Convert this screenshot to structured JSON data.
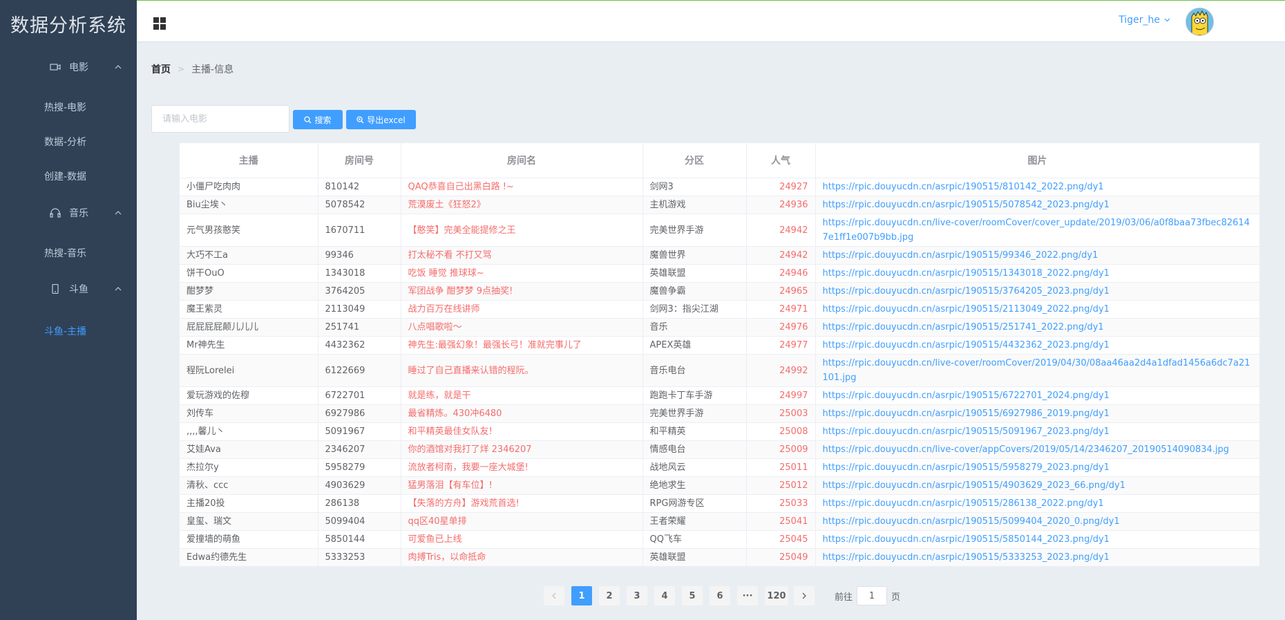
{
  "app": {
    "title": "数据分析系统"
  },
  "sidebar": {
    "groups": [
      {
        "label": "电影",
        "icon": "video-camera-icon",
        "items": [
          "热搜-电影",
          "数据-分析",
          "创建-数据"
        ]
      },
      {
        "label": "音乐",
        "icon": "headset-icon",
        "items": [
          "热搜-音乐"
        ]
      },
      {
        "label": "斗鱼",
        "icon": "mobile-phone-icon",
        "items": [
          "斗鱼-主播"
        ]
      }
    ],
    "active_item": "斗鱼-主播"
  },
  "header": {
    "username": "Tiger_he"
  },
  "breadcrumb": {
    "home": "首页",
    "current": "主播-信息"
  },
  "toolbar": {
    "search_placeholder": "请输入电影",
    "search_label": "搜索",
    "export_label": "导出excel"
  },
  "table": {
    "columns": [
      "主播",
      "房间号",
      "房间名",
      "分区",
      "人气",
      "图片"
    ],
    "rows": [
      [
        "小僵尸吃肉肉",
        "810142",
        "QAQ恭喜自己出黑白路 !~",
        "剑网3",
        "24927",
        "https://rpic.douyucdn.cn/asrpic/190515/810142_2022.png/dy1"
      ],
      [
        "Biu尘埃丶",
        "5078542",
        "荒漠废土《狂怒2》",
        "主机游戏",
        "24936",
        "https://rpic.douyucdn.cn/asrpic/190515/5078542_2023.png/dy1"
      ],
      [
        "元气男孩憨笑",
        "1670711",
        "【憨笑】完美全能提修之王",
        "完美世界手游",
        "24942",
        "https://rpic.douyucdn.cn/live-cover/roomCover/cover_update/2019/03/06/a0f8baa73fbec826147e1ff1e007b9bb.jpg"
      ],
      [
        "大巧不工a",
        "99346",
        "打太秘不看 不打又骂",
        "魔兽世界",
        "24942",
        "https://rpic.douyucdn.cn/asrpic/190515/99346_2022.png/dy1"
      ],
      [
        "饼干OuO",
        "1343018",
        "吃饭 睡觉 推球球~",
        "英雄联盟",
        "24946",
        "https://rpic.douyucdn.cn/asrpic/190515/1343018_2022.png/dy1"
      ],
      [
        "酣梦梦",
        "3764205",
        "军团战争 酣梦梦 9点抽奖!",
        "魔兽争霸",
        "24965",
        "https://rpic.douyucdn.cn/asrpic/190515/3764205_2023.png/dy1"
      ],
      [
        "魔王紫灵",
        "2113049",
        "战力百万在线讲师",
        "剑网3：指尖江湖",
        "24971",
        "https://rpic.douyucdn.cn/asrpic/190515/2113049_2022.png/dy1"
      ],
      [
        "屁屁屁屁颠儿儿儿",
        "251741",
        "八点唱歌啦～",
        "音乐",
        "24976",
        "https://rpic.douyucdn.cn/asrpic/190515/251741_2022.png/dy1"
      ],
      [
        "Mr神先生",
        "4432362",
        "神先生:最强幻象！最强长弓！准就完事儿了",
        "APEX英雄",
        "24977",
        "https://rpic.douyucdn.cn/asrpic/190515/4432362_2023.png/dy1"
      ],
      [
        "程阮Lorelei",
        "6122669",
        "睡过了自己直播来认错的程阮。",
        "音乐电台",
        "24992",
        "https://rpic.douyucdn.cn/live-cover/roomCover/2019/04/30/08aa46aa2d4a1dfad1456a6dc7a21101.jpg"
      ],
      [
        "爱玩游戏的佐穆",
        "6722701",
        "就是练，就是干",
        "跑跑卡丁车手游",
        "24997",
        "https://rpic.douyucdn.cn/asrpic/190515/6722701_2024.png/dy1"
      ],
      [
        "刘传车",
        "6927986",
        "最省精炼。430冲6480",
        "完美世界手游",
        "25003",
        "https://rpic.douyucdn.cn/asrpic/190515/6927986_2019.png/dy1"
      ],
      [
        ",,,,馨儿丶",
        "5091967",
        "和平精英最佳女队友!",
        "和平精英",
        "25008",
        "https://rpic.douyucdn.cn/asrpic/190515/5091967_2023.png/dy1"
      ],
      [
        "艾娃Ava",
        "2346207",
        "你的酒馆对我打了烊 2346207",
        "情感电台",
        "25009",
        "https://rpic.douyucdn.cn/live-cover/appCovers/2019/05/14/2346207_20190514090834.jpg"
      ],
      [
        "杰拉尔y",
        "5958279",
        "流放者柯南，我要一座大城堡!",
        "战地风云",
        "25011",
        "https://rpic.douyucdn.cn/asrpic/190515/5958279_2023.png/dy1"
      ],
      [
        "清秋、ccc",
        "4903629",
        "猛男落泪【有车位】!",
        "绝地求生",
        "25012",
        "https://rpic.douyucdn.cn/asrpic/190515/4903629_2023_66.png/dy1"
      ],
      [
        "主播20投",
        "286138",
        "【失落的方舟】游戏荒首选!",
        "RPG网游专区",
        "25033",
        "https://rpic.douyucdn.cn/asrpic/190515/286138_2022.png/dy1"
      ],
      [
        "皇玺、瑞文",
        "5099404",
        "qq区40星单排",
        "王者荣耀",
        "25041",
        "https://rpic.douyucdn.cn/asrpic/190515/5099404_2020_0.png/dy1"
      ],
      [
        "爱撞墙的萌鱼",
        "5850144",
        "可爱鱼已上线",
        "QQ飞车",
        "25045",
        "https://rpic.douyucdn.cn/asrpic/190515/5850144_2023.png/dy1"
      ],
      [
        "Edwa约德先生",
        "5333253",
        "肉搏Tris，以命抵命",
        "英雄联盟",
        "25049",
        "https://rpic.douyucdn.cn/asrpic/190515/5333253_2023.png/dy1"
      ]
    ]
  },
  "pagination": {
    "pages": [
      "1",
      "2",
      "3",
      "4",
      "5",
      "6",
      "···",
      "120"
    ],
    "current_page": 1,
    "goto_prefix": "前往",
    "goto_value": "1",
    "goto_suffix": "页"
  },
  "colors": {
    "sidebar_bg": "#304156",
    "accent": "#409eff",
    "danger": "#f56c6c",
    "content_bg": "#e9eef3"
  }
}
